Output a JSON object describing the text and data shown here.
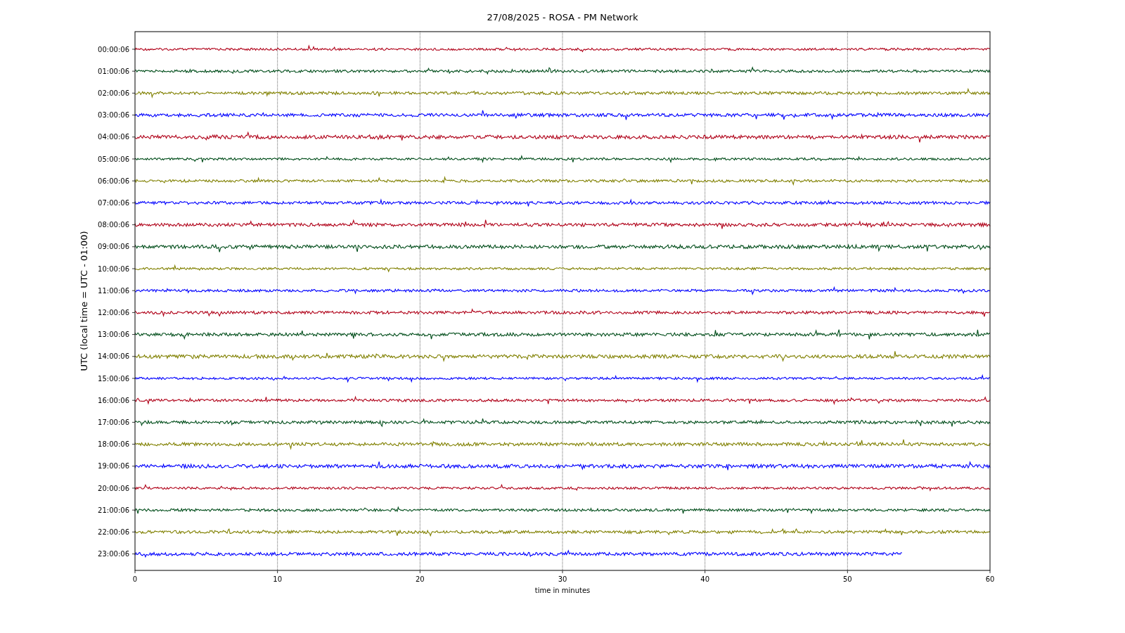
{
  "title": "27/08/2025 - ROSA - PM Network",
  "ylabel": "UTC (local time = UTC - 01:00)",
  "xlabel": "time in minutes",
  "xticks": [
    "0",
    "10",
    "20",
    "30",
    "40",
    "50",
    "60"
  ],
  "traces": [
    {
      "label": "00:00:06",
      "color": "#b00018",
      "level": 1
    },
    {
      "label": "01:00:06",
      "color": "#004d1a",
      "level": 1
    },
    {
      "label": "02:00:06",
      "color": "#808000",
      "level": 1
    },
    {
      "label": "03:00:06",
      "color": "#0000ff",
      "level": 1
    },
    {
      "label": "04:00:06",
      "color": "#b00018",
      "level": 1
    },
    {
      "label": "05:00:06",
      "color": "#004d1a",
      "level": 1
    },
    {
      "label": "06:00:06",
      "color": "#808000",
      "level": 1
    },
    {
      "label": "07:00:06",
      "color": "#0000ff",
      "level": 1
    },
    {
      "label": "08:00:06",
      "color": "#b00018",
      "level": 1
    },
    {
      "label": "09:00:06",
      "color": "#004d1a",
      "level": 1
    },
    {
      "label": "10:00:06",
      "color": "#808000",
      "level": 1
    },
    {
      "label": "11:00:06",
      "color": "#0000ff",
      "level": 1
    },
    {
      "label": "12:00:06",
      "color": "#b00018",
      "level": 1
    },
    {
      "label": "13:00:06",
      "color": "#004d1a",
      "level": 1
    },
    {
      "label": "14:00:06",
      "color": "#808000",
      "level": 1
    },
    {
      "label": "15:00:06",
      "color": "#0000ff",
      "level": 1
    },
    {
      "label": "16:00:06",
      "color": "#b00018",
      "level": 1
    },
    {
      "label": "17:00:06",
      "color": "#004d1a",
      "level": 1
    },
    {
      "label": "18:00:06",
      "color": "#808000",
      "level": 1
    },
    {
      "label": "19:00:06",
      "color": "#0000ff",
      "level": 1
    },
    {
      "label": "20:00:06",
      "color": "#b00018",
      "level": 1
    },
    {
      "label": "21:00:06",
      "color": "#004d1a",
      "level": 1
    },
    {
      "label": "22:00:06",
      "color": "#808000",
      "level": 1
    },
    {
      "label": "23:00:06",
      "color": "#0000ff",
      "level": 0.897
    }
  ]
}
